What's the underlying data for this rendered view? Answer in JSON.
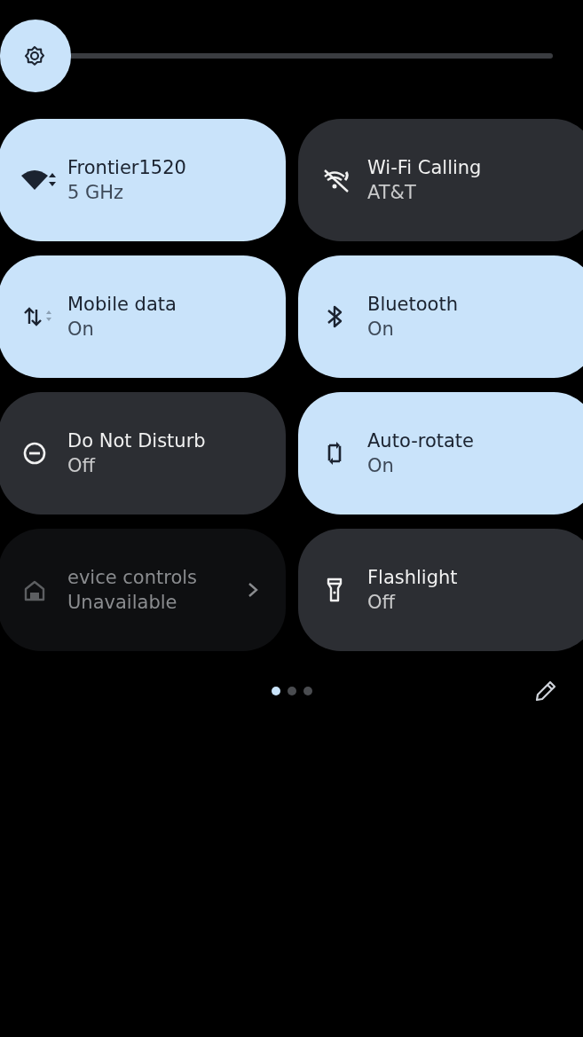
{
  "brightness": {
    "level": 0
  },
  "tiles": [
    {
      "kind": "wifi",
      "title": "Frontier1520",
      "subtitle": "5 GHz",
      "active": true,
      "disabled": false
    },
    {
      "kind": "wifi-calling",
      "title": "Wi-Fi Calling",
      "subtitle": "AT&T",
      "active": false,
      "disabled": false
    },
    {
      "kind": "mobile-data",
      "title": "Mobile data",
      "subtitle": "On",
      "active": true,
      "disabled": false
    },
    {
      "kind": "bluetooth",
      "title": "Bluetooth",
      "subtitle": "On",
      "active": true,
      "disabled": false
    },
    {
      "kind": "dnd",
      "title": "Do Not Disturb",
      "subtitle": "Off",
      "active": false,
      "disabled": false
    },
    {
      "kind": "rotate",
      "title": "Auto-rotate",
      "subtitle": "On",
      "active": true,
      "disabled": false
    },
    {
      "kind": "home",
      "title": "evice controls",
      "subtitle": "Unavailable",
      "disabled": true,
      "chevron": true
    },
    {
      "kind": "flashlight",
      "title": "Flashlight",
      "subtitle": "Off",
      "active": false,
      "disabled": false
    }
  ],
  "pages": [
    {
      "selected": true
    },
    {
      "selected": false
    },
    {
      "selected": false
    }
  ],
  "edit": {
    "kind": "pencil"
  }
}
